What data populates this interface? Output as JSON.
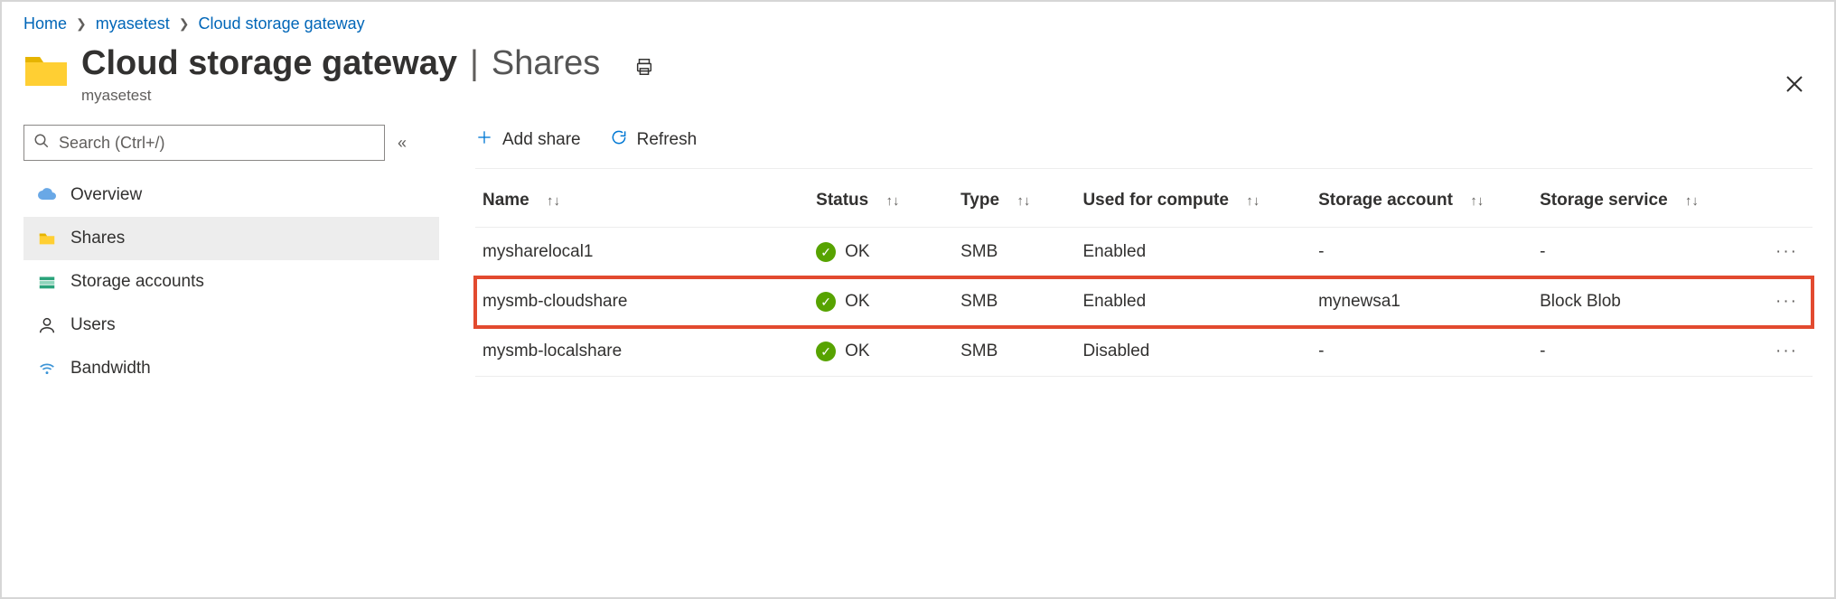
{
  "breadcrumb": {
    "home": "Home",
    "item1": "myasetest",
    "item2": "Cloud storage gateway"
  },
  "header": {
    "title": "Cloud storage gateway",
    "section": "Shares",
    "subtitle": "myasetest"
  },
  "search": {
    "placeholder": "Search (Ctrl+/)"
  },
  "sidebar": {
    "items": {
      "overview": {
        "label": "Overview"
      },
      "shares": {
        "label": "Shares"
      },
      "storage": {
        "label": "Storage accounts"
      },
      "users": {
        "label": "Users"
      },
      "bandwidth": {
        "label": "Bandwidth"
      }
    }
  },
  "toolbar": {
    "add_share": "Add share",
    "refresh": "Refresh"
  },
  "table": {
    "headers": {
      "name": "Name",
      "status": "Status",
      "type": "Type",
      "compute": "Used for compute",
      "account": "Storage account",
      "service": "Storage service"
    },
    "rows": [
      {
        "name": "mysharelocal1",
        "status": "OK",
        "type": "SMB",
        "compute": "Enabled",
        "account": "-",
        "service": "-",
        "highlight": false
      },
      {
        "name": "mysmb-cloudshare",
        "status": "OK",
        "type": "SMB",
        "compute": "Enabled",
        "account": "mynewsa1",
        "service": "Block Blob",
        "highlight": true
      },
      {
        "name": "mysmb-localshare",
        "status": "OK",
        "type": "SMB",
        "compute": "Disabled",
        "account": "-",
        "service": "-",
        "highlight": false
      }
    ]
  }
}
